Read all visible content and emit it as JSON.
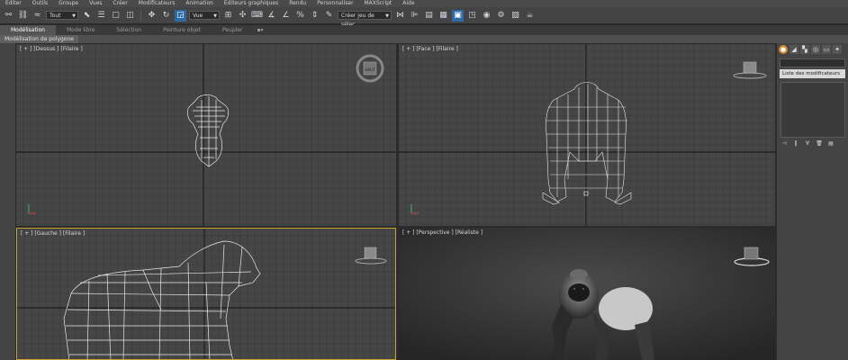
{
  "menu": [
    "Editer",
    "Outils",
    "Groupe",
    "Vues",
    "Créer",
    "Modificateurs",
    "Animation",
    "Editeurs graphiques",
    "Rendu",
    "Personnaliser",
    "MAXScript",
    "Aide"
  ],
  "toolbar": {
    "selection_filter": "Tout",
    "reference_coord": "Vue",
    "named_selection_placeholder": "Créer jeu de sélec"
  },
  "ribbon_tabs": [
    {
      "label": "Modélisation",
      "active": true
    },
    {
      "label": "Mode libre",
      "active": false
    },
    {
      "label": "Sélection",
      "active": false
    },
    {
      "label": "Peinture objet",
      "active": false
    },
    {
      "label": "Peupler",
      "active": false
    }
  ],
  "ribbon_sub": "Modélisation de polygone",
  "viewports": {
    "top": {
      "label": "[ + ] [Dessus ] [Filaire ]"
    },
    "front": {
      "label": "[ + ] [Face ] [Filaire ]"
    },
    "left": {
      "label": "[ + ] [Gauche ] [Filaire ]"
    },
    "perspective": {
      "label": "[ + ] [Perspective ] [Réaliste ]"
    }
  },
  "viewcube": {
    "top_face": "HAUT"
  },
  "command_panel": {
    "modifier_list": "Liste des modificateurs"
  },
  "colors": {
    "active_border": "#c9a230",
    "grid_minor": "#3a3a3a",
    "grid_major": "#1c1c1c",
    "wire": "#e8e8e8",
    "selection_blue": "#2e6aa8",
    "create_tab_orange": "#d68a2a"
  }
}
